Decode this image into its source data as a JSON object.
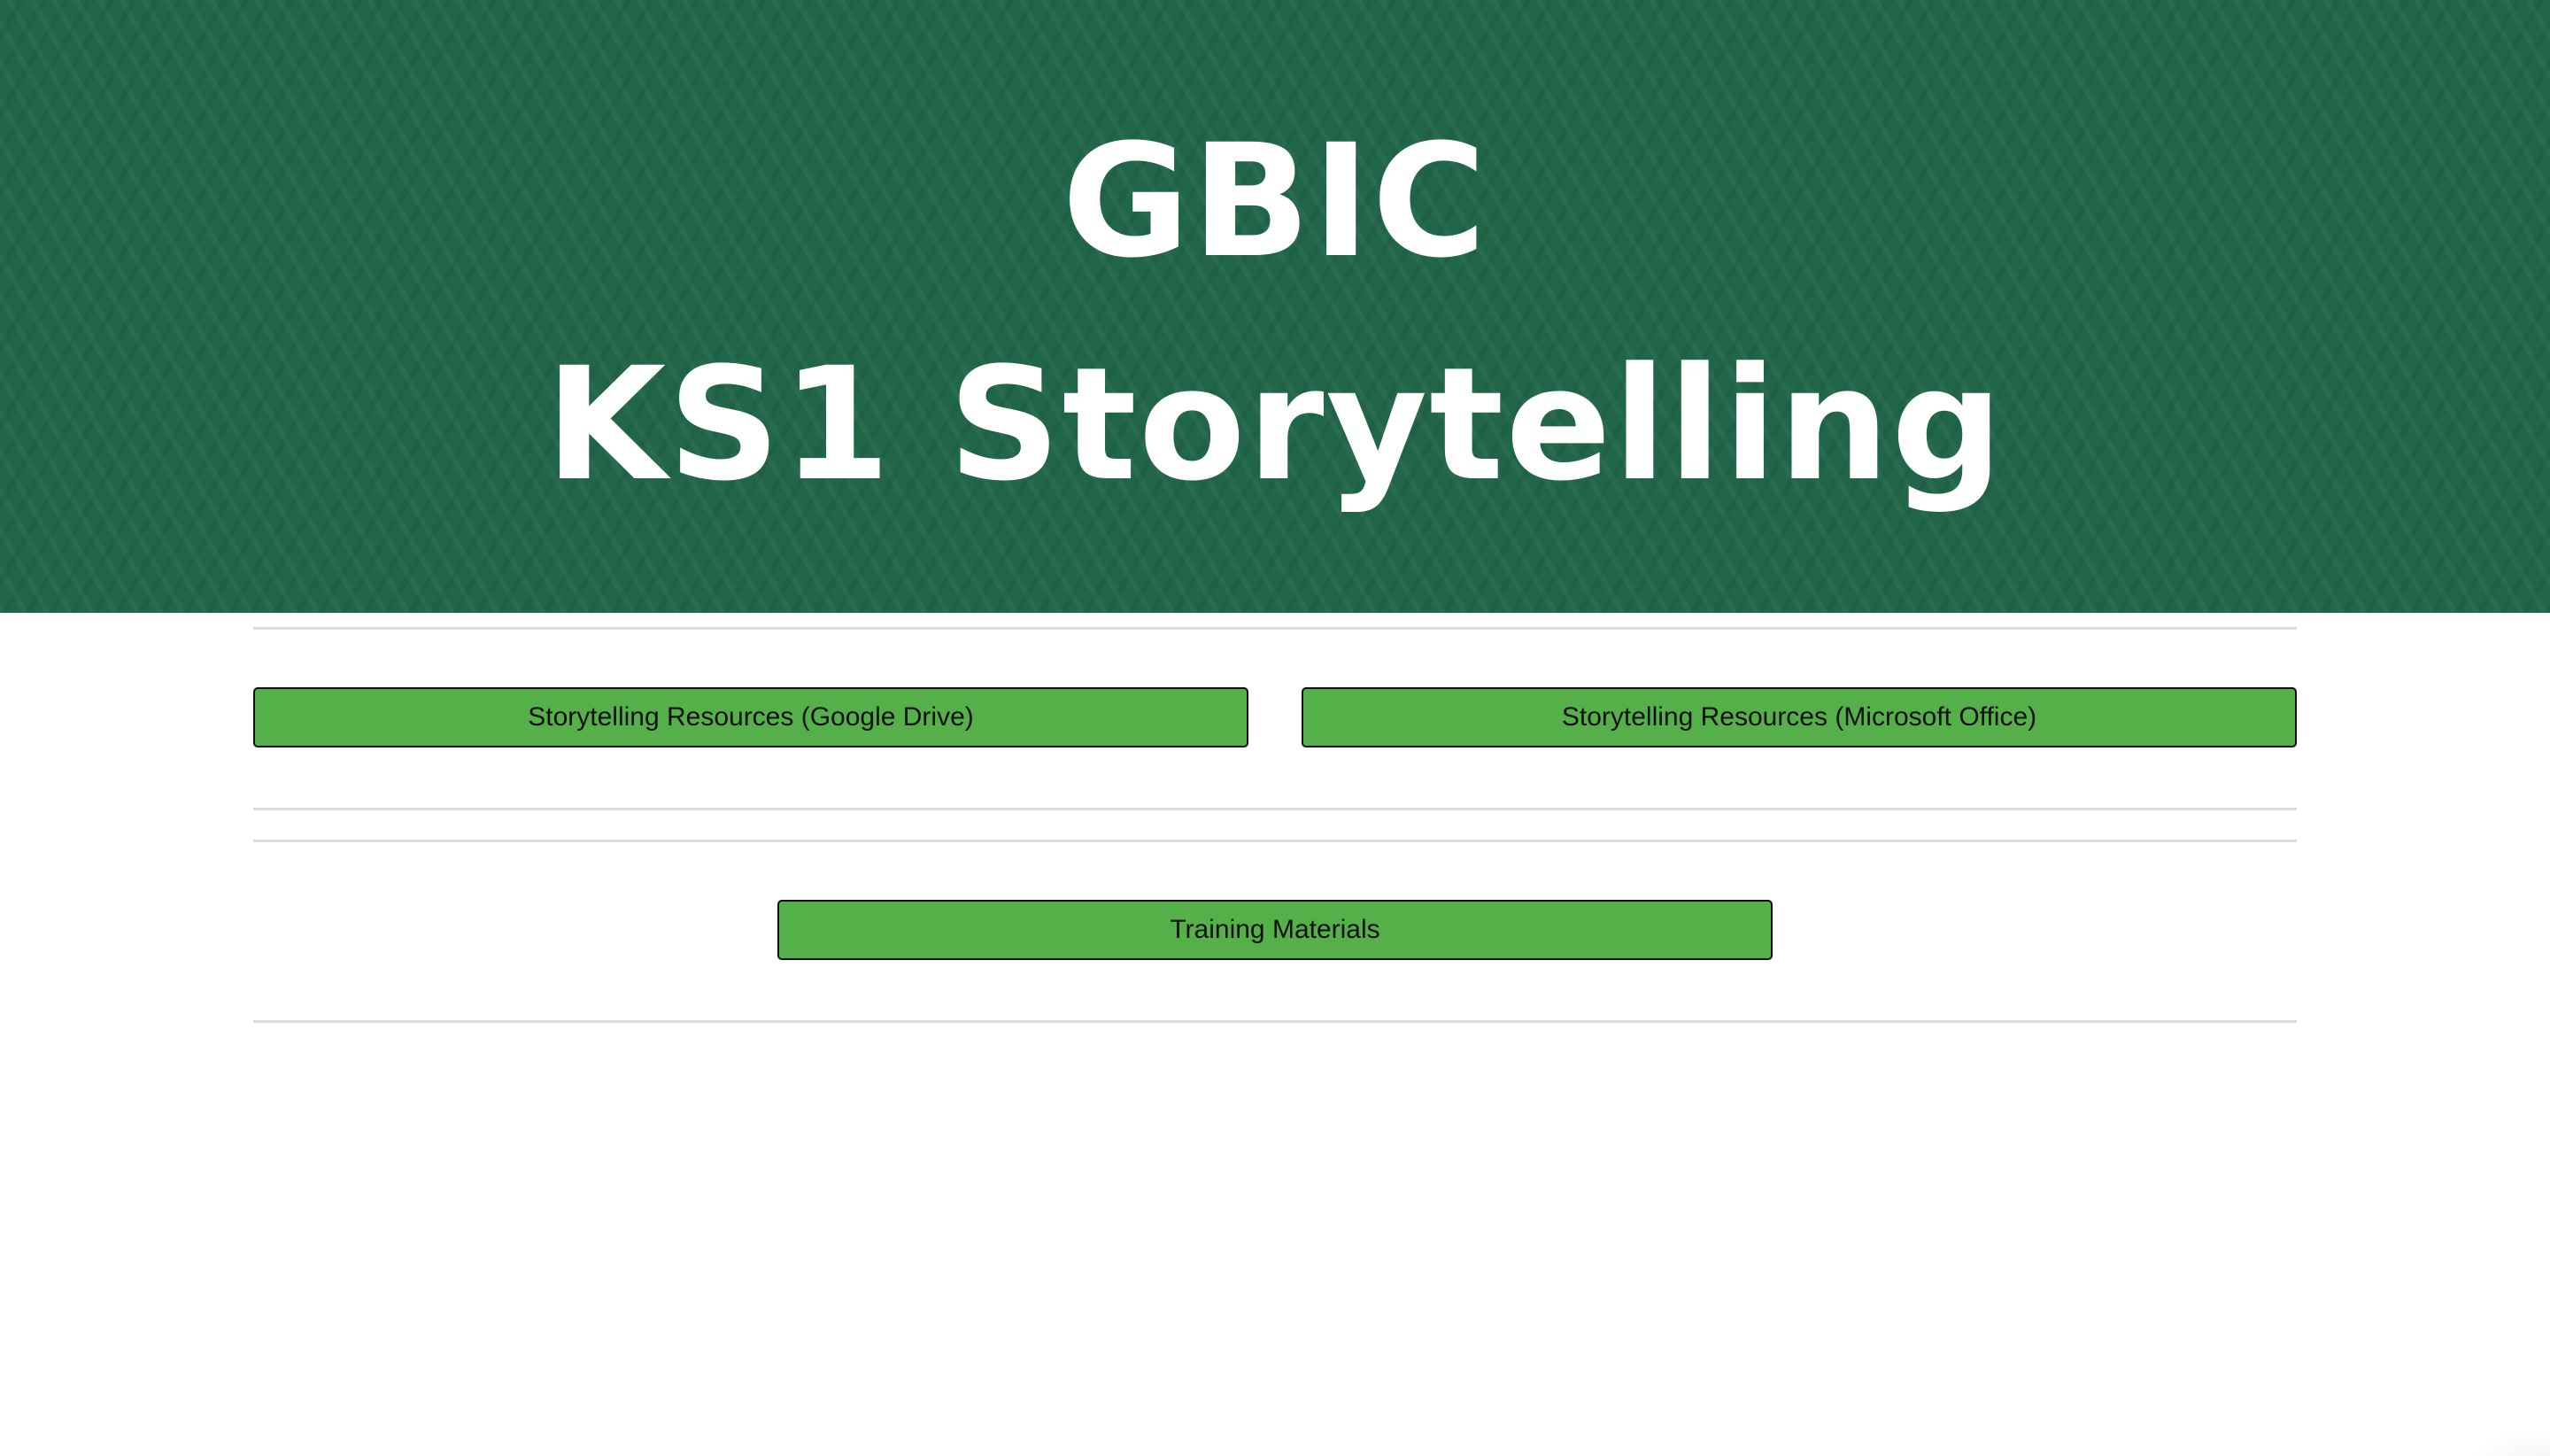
{
  "header": {
    "title_line_1": "GBIC",
    "title_line_2": "KS1 Storytelling",
    "background_color": "#21664a"
  },
  "resources": {
    "google_drive_label": "Storytelling Resources (Google Drive)",
    "microsoft_office_label": "Storytelling Resources (Microsoft Office)"
  },
  "training": {
    "label": "Training Materials"
  },
  "colors": {
    "button_green": "#56b04a",
    "text_white": "#ffffff",
    "divider": "#dcdcdc"
  }
}
